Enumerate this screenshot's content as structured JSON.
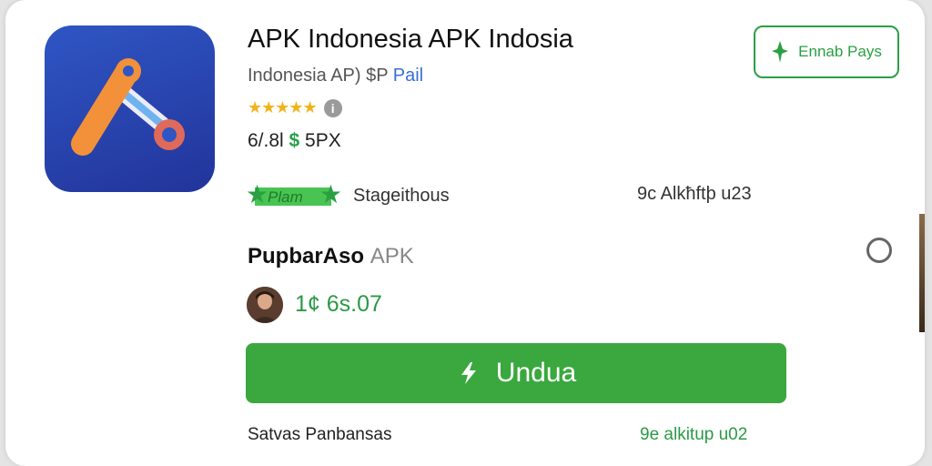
{
  "app": {
    "title": "APK Indonesia APK Indosia",
    "subtitle_main": "Indonesia AP) $P ",
    "subtitle_accent": "Pail",
    "stars": "★★★★★",
    "info_icon": "info-icon",
    "size_prefix": "6/.8l ",
    "size_dollar": "$",
    "size_suffix": " 5PX"
  },
  "header_button": {
    "label": "Ennab Pays",
    "icon": "pin-icon"
  },
  "tag": {
    "badge_label": "Plam",
    "text": "Stageithous"
  },
  "meta_right": "9c Alkћftþ u23",
  "section": {
    "title_bold": "PupbarAso ",
    "title_light": "APK"
  },
  "price": "1¢ 6s.07",
  "download_button": {
    "label": "Undua",
    "icon": "bolt-icon"
  },
  "footer": {
    "left": "Satvas Panbansas",
    "right": "9e alkitup u02"
  },
  "colors": {
    "accent_green": "#3aa83e",
    "icon_bg": "#2f56c4",
    "star": "#f2b31a"
  }
}
